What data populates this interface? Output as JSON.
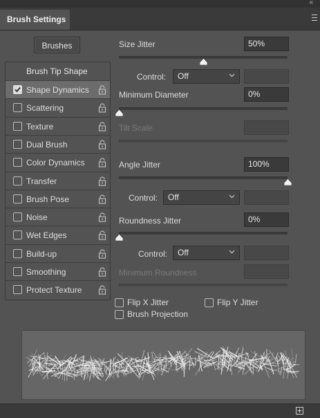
{
  "panel": {
    "title": "Brush Settings",
    "collapse_glyph": "«"
  },
  "brushes_button": "Brushes",
  "sidebar": {
    "header": "Brush Tip Shape",
    "items": [
      {
        "label": "Shape Dynamics",
        "checked": true,
        "selected": true
      },
      {
        "label": "Scattering",
        "checked": false
      },
      {
        "label": "Texture",
        "checked": false
      },
      {
        "label": "Dual Brush",
        "checked": false
      },
      {
        "label": "Color Dynamics",
        "checked": false
      },
      {
        "label": "Transfer",
        "checked": false
      },
      {
        "label": "Brush Pose",
        "checked": false
      },
      {
        "label": "Noise",
        "checked": false
      },
      {
        "label": "Wet Edges",
        "checked": false
      },
      {
        "label": "Build-up",
        "checked": false
      },
      {
        "label": "Smoothing",
        "checked": false
      },
      {
        "label": "Protect Texture",
        "checked": false
      }
    ]
  },
  "settings": {
    "size_jitter": {
      "label": "Size Jitter",
      "value": "50%",
      "slider_fraction": 0.5
    },
    "control1": {
      "label": "Control:",
      "value": "Off"
    },
    "minimum_diameter": {
      "label": "Minimum Diameter",
      "value": "0%",
      "slider_fraction": 0.0
    },
    "tilt_scale": {
      "label": "Tilt Scale",
      "disabled": true
    },
    "angle_jitter": {
      "label": "Angle Jitter",
      "value": "100%",
      "slider_fraction": 1.0
    },
    "control2": {
      "label": "Control:",
      "value": "Off"
    },
    "roundness_jitter": {
      "label": "Roundness Jitter",
      "value": "0%",
      "slider_fraction": 0.0
    },
    "control3": {
      "label": "Control:",
      "value": "Off"
    },
    "minimum_roundness": {
      "label": "Minimum Roundness",
      "disabled": true
    }
  },
  "options": {
    "flip_x": {
      "label": "Flip X Jitter",
      "checked": false
    },
    "flip_y": {
      "label": "Flip Y Jitter",
      "checked": false
    },
    "brush_projection": {
      "label": "Brush Projection",
      "checked": false
    }
  },
  "icons": {
    "lock": "lock-icon",
    "menu": "panel-menu-icon",
    "new_preset": "create-new-brush-icon"
  }
}
